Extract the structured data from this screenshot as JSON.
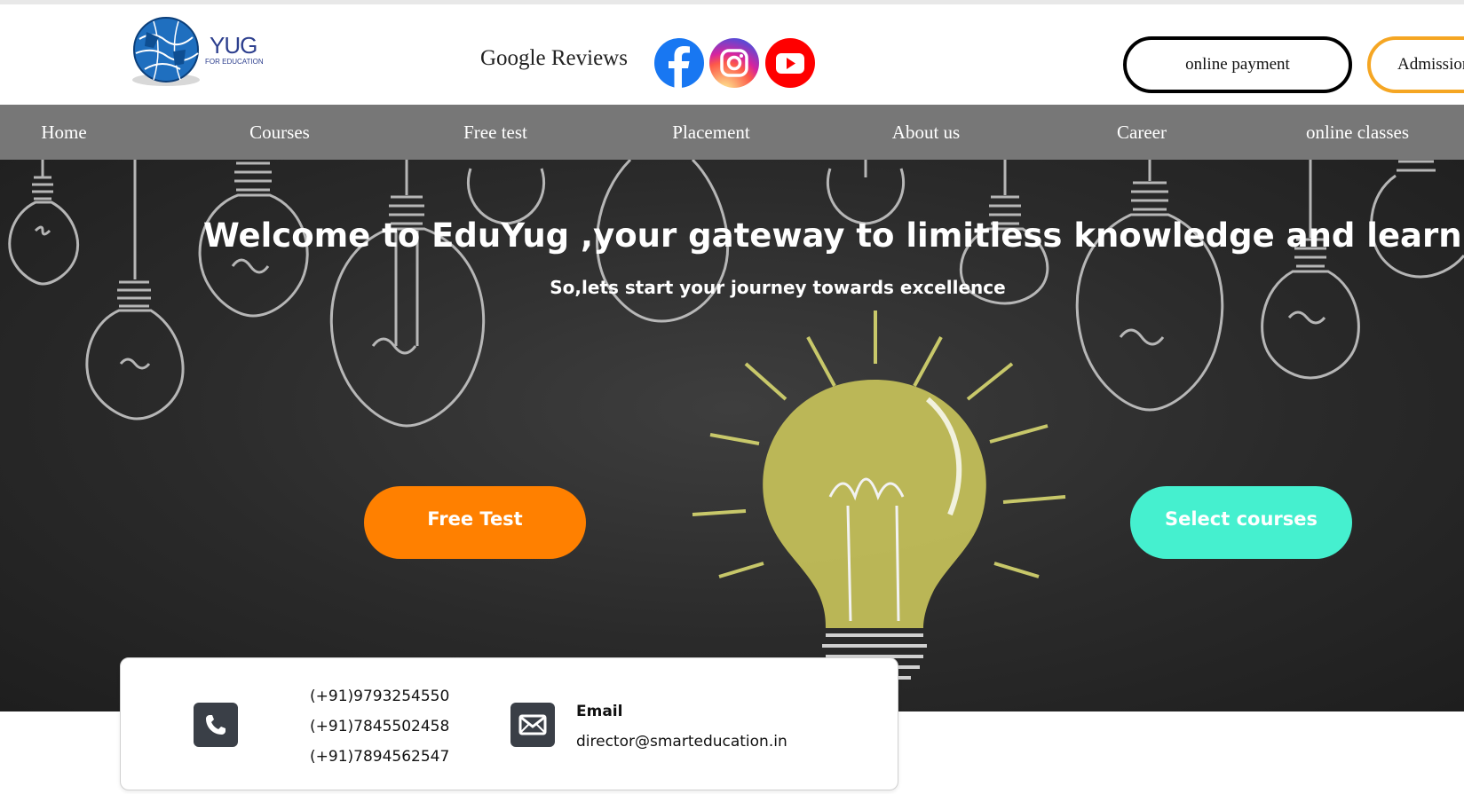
{
  "header": {
    "logo": {
      "name": "YUG",
      "tagline": "FOR EDUCATION"
    },
    "google_reviews": "Google Reviews",
    "social": [
      "facebook-icon",
      "instagram-icon",
      "youtube-icon"
    ],
    "online_payment": "online payment",
    "admission": "Admission"
  },
  "nav": {
    "items": [
      {
        "label": "Home"
      },
      {
        "label": "Courses"
      },
      {
        "label": "Free test"
      },
      {
        "label": "Placement"
      },
      {
        "label": "About us"
      },
      {
        "label": "Career"
      },
      {
        "label": "online classes"
      }
    ]
  },
  "hero": {
    "title": "Welcome to EduYug ,your gateway to limitless knowledge and learning oppurtunities",
    "subtitle": "So,lets start your journey towards excellence",
    "free_test": "Free Test",
    "select_courses": "Select courses"
  },
  "contact": {
    "phones": [
      "(+91)9793254550",
      "(+91)7845502458",
      "(+91)7894562547"
    ],
    "email_label": "Email",
    "email": "director@smarteducation.in"
  },
  "colors": {
    "nav_bg": "#777777",
    "free_test": "#ff8000",
    "select_courses": "#45f0cf",
    "admission_border": "#f5a623"
  }
}
